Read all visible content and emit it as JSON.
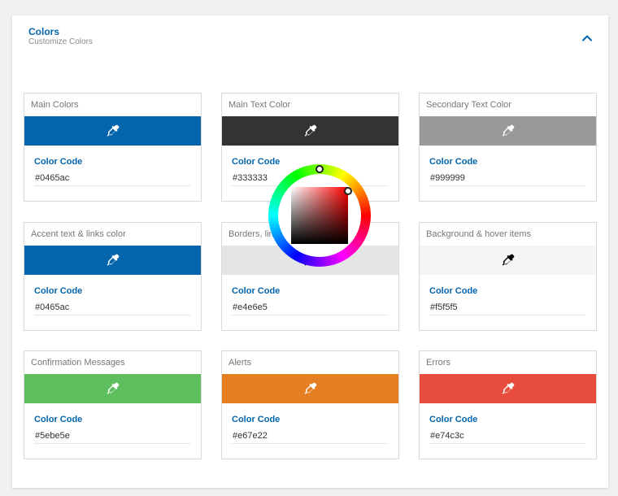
{
  "header": {
    "title": "Colors",
    "subtitle": "Customize Colors"
  },
  "code_label": "Color Code",
  "cards": [
    {
      "label": "Main Colors",
      "value": "#0465ac",
      "color": "#0465ac",
      "icon": "eyedropper-icon",
      "icon_color": "#ffffff"
    },
    {
      "label": "Main Text Color",
      "value": "#333333",
      "color": "#333333",
      "icon": "eyedropper-icon",
      "icon_color": "#ffffff"
    },
    {
      "label": "Secondary Text Color",
      "value": "#999999",
      "color": "#999999",
      "icon": "eyedropper-icon",
      "icon_color": "#ffffff"
    },
    {
      "label": "Accent text & links color",
      "value": "#0465ac",
      "color": "#0465ac",
      "icon": "eyedropper-icon",
      "icon_color": "#ffffff"
    },
    {
      "label": "Borders, lin",
      "value": "#e4e6e5",
      "color": "#e4e6e5",
      "icon": "eyedropper-icon",
      "icon_color": "#000000"
    },
    {
      "label": "Background & hover items",
      "value": "#f5f5f5",
      "color": "#f5f5f5",
      "icon": "eyedropper-icon",
      "icon_color": "#000000"
    },
    {
      "label": "Confirmation Messages",
      "value": "#5ebe5e",
      "color": "#5ebe5e",
      "icon": "eyedropper-icon",
      "icon_color": "#ffffff"
    },
    {
      "label": "Alerts",
      "value": "#e67e22",
      "color": "#e67e22",
      "icon": "eyedropper-icon",
      "icon_color": "#ffffff"
    },
    {
      "label": "Errors",
      "value": "#e74c3c",
      "color": "#e74c3c",
      "icon": "eyedropper-icon",
      "icon_color": "#ffffff"
    }
  ],
  "colors": {
    "accent": "#0465ac",
    "subtitle": "#8a8a8a",
    "border": "#d9d9d9"
  }
}
